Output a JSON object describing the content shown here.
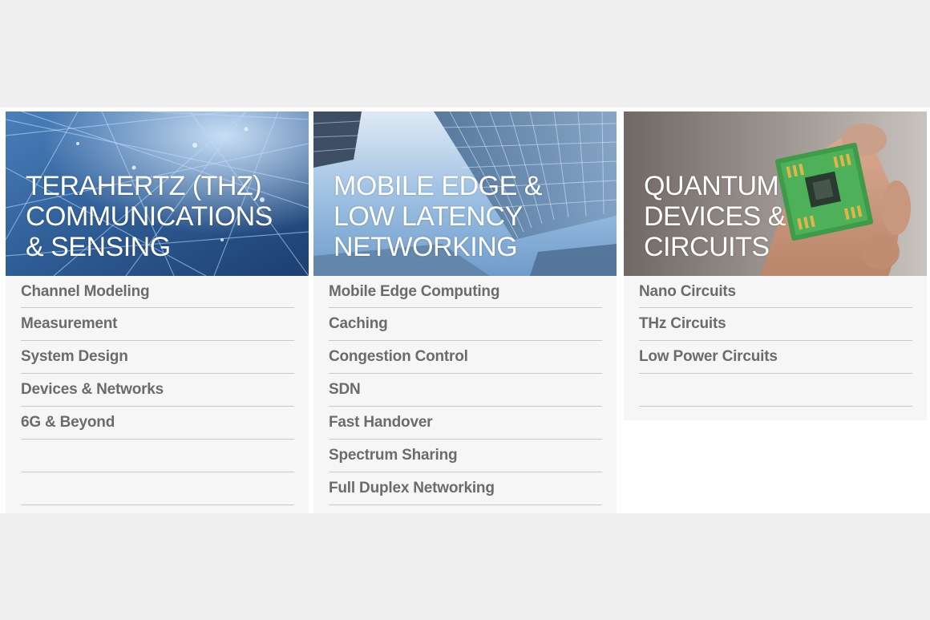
{
  "cards": [
    {
      "title": "TERAHERTZ (THZ)\nCOMMUNICATIONS\n& SENSING",
      "accent": "#2f5e96",
      "items": [
        "Channel Modeling",
        "Measurement",
        "System Design",
        "Devices & Networks",
        "6G & Beyond",
        "",
        ""
      ]
    },
    {
      "title": "MOBILE EDGE &\nLOW LATENCY\nNETWORKING",
      "accent": "#7fa9d6",
      "items": [
        "Mobile Edge Computing",
        "Caching",
        "Congestion Control",
        "SDN",
        "Fast Handover",
        "Spectrum Sharing",
        "Full Duplex Networking"
      ]
    },
    {
      "title": "QUANTUM\nDEVICES &\nCIRCUITS",
      "accent": "#8a8480",
      "items": [
        "Nano Circuits",
        "THz Circuits",
        "Low Power Circuits",
        ""
      ]
    }
  ],
  "colors": {
    "page_background": "#efefef",
    "strip_background": "#ffffff",
    "card_background": "#f6f6f6",
    "topic_text": "#6b6b6b",
    "divider": "#c9c9c9"
  },
  "icons": {
    "card1_banner": "network-lines-image",
    "card2_banner": "skyscrapers-image",
    "card3_banner": "chip-in-hand-image"
  }
}
